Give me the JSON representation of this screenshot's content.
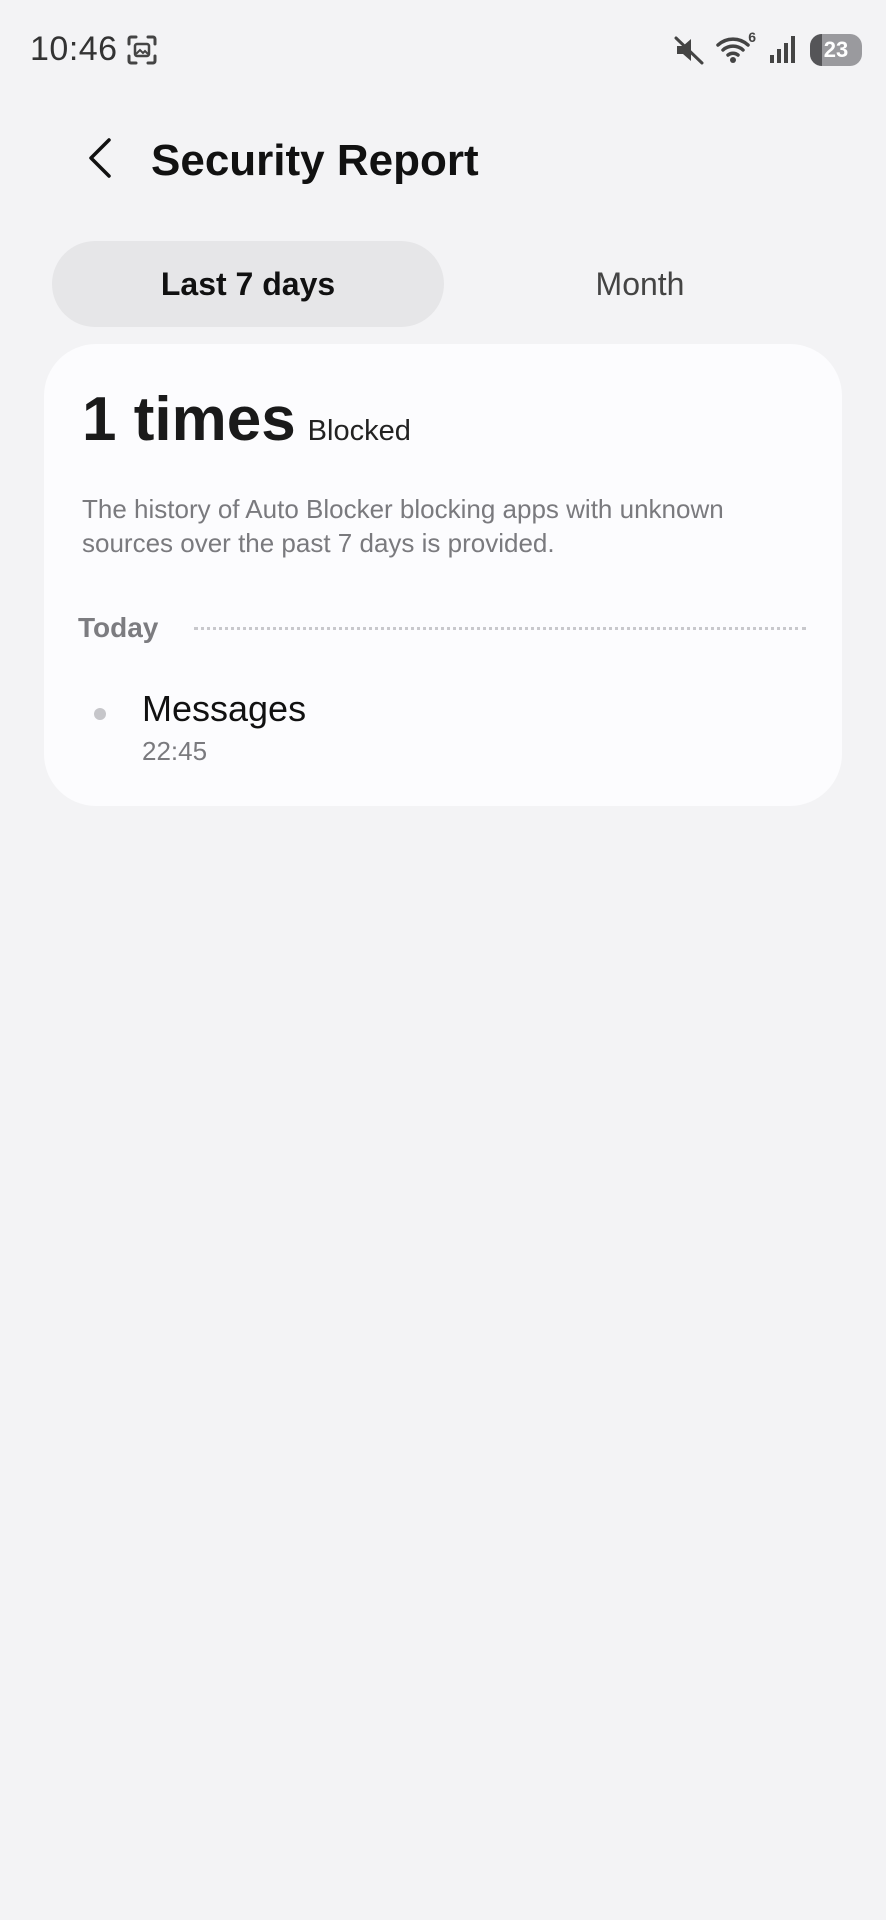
{
  "status_bar": {
    "time": "10:46",
    "left_icon": "screenshot-frame-icon",
    "right_icons": [
      "mute-icon",
      "wifi-6-icon",
      "signal-icon"
    ],
    "wifi_badge": "6",
    "battery_level": "23",
    "battery_fraction": 0.23
  },
  "header": {
    "back_icon": "chevron-left-icon",
    "title": "Security Report"
  },
  "tabs": [
    {
      "label": "Last 7 days",
      "active": true
    },
    {
      "label": "Month",
      "active": false
    }
  ],
  "summary": {
    "count": "1 times",
    "count_label": "Blocked",
    "description": "The history of Auto Blocker blocking apps with unknown sources over the past 7 days is provided."
  },
  "history": {
    "section_label": "Today",
    "entries": [
      {
        "title": "Messages",
        "time": "22:45"
      }
    ]
  },
  "colors": {
    "background": "#f3f3f5",
    "card": "#fcfcfe",
    "active_tab": "#e6e6e8",
    "muted_text": "#7a7a7e"
  }
}
